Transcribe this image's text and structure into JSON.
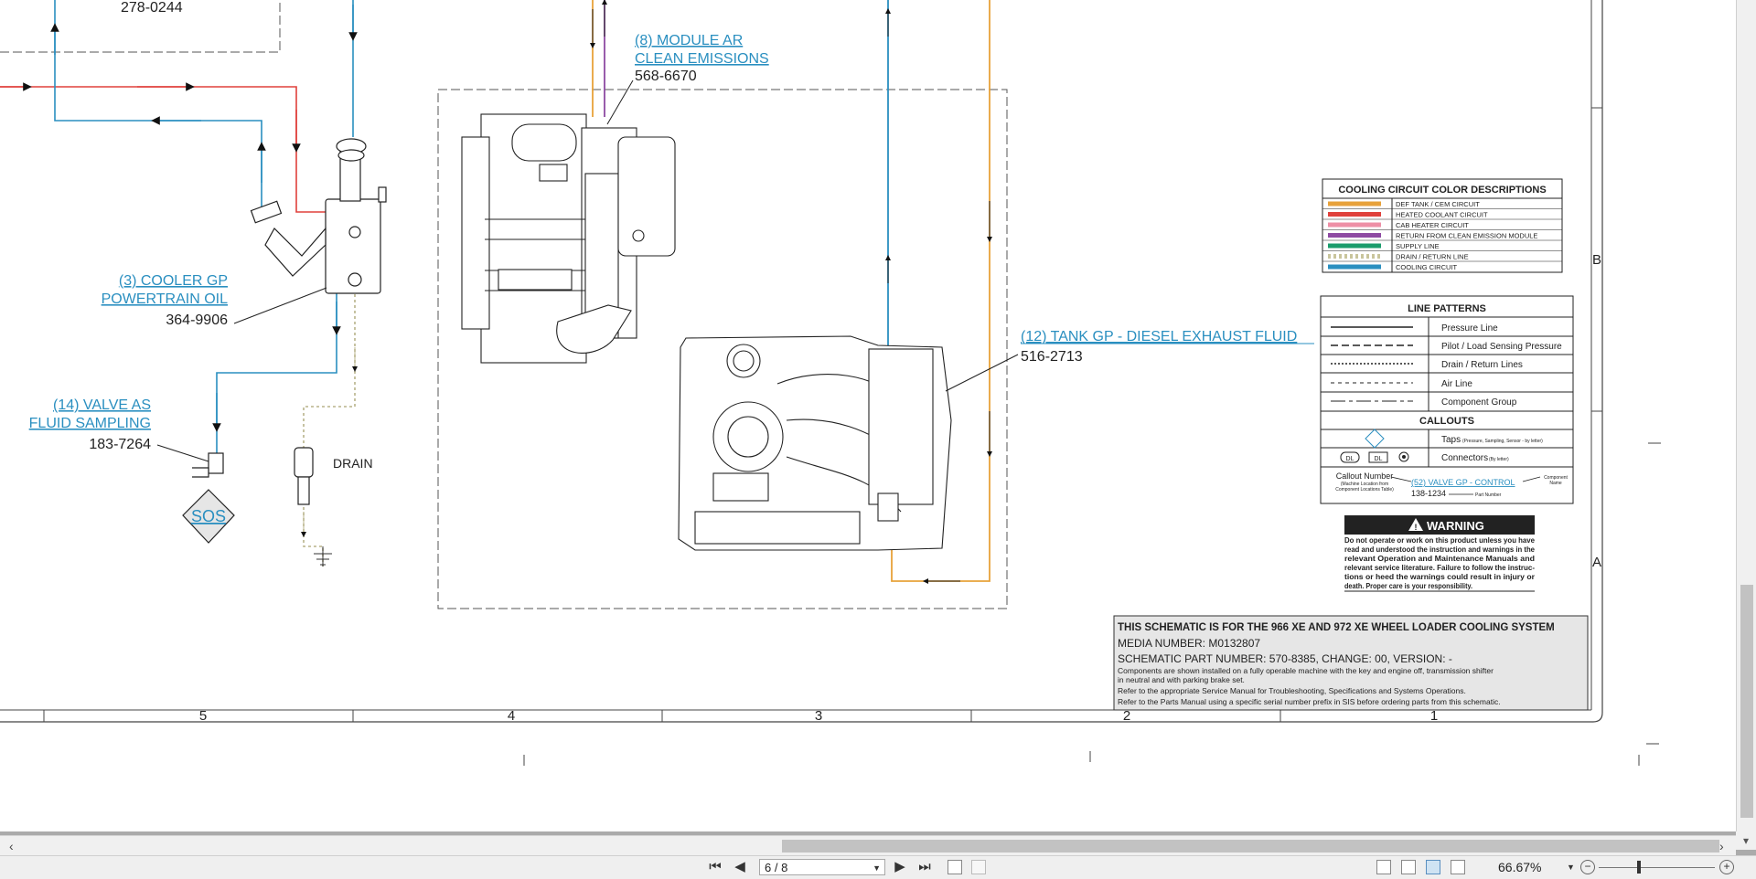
{
  "viewer": {
    "page_indicator": "6 / 8",
    "zoom": "66.67%"
  },
  "schematic": {
    "top_left_number": "278-0244",
    "callouts": {
      "module_ar": {
        "label_line1": "(8) MODULE AR",
        "label_line2": "CLEAN EMISSIONS",
        "part": "568-6670"
      },
      "cooler": {
        "label_line1": "(3) COOLER GP",
        "label_line2": "POWERTRAIN OIL",
        "part": "364-9906"
      },
      "valve": {
        "label_line1": "(14) VALVE AS",
        "label_line2": "FLUID SAMPLING",
        "part": "183-7264"
      },
      "tank": {
        "label": "(12) TANK GP - DIESEL EXHAUST FLUID",
        "part": "516-2713"
      }
    },
    "sos_label": "SOS",
    "drain_label": "DRAIN",
    "row_markers": [
      "B",
      "A"
    ],
    "column_numbers": [
      "5",
      "4",
      "3",
      "2",
      "1"
    ]
  },
  "legend_colors": {
    "title": "COOLING CIRCUIT COLOR DESCRIPTIONS",
    "items": [
      {
        "label": "DEF TANK / CEM CIRCUIT",
        "color": "#e8a23a"
      },
      {
        "label": "HEATED COOLANT CIRCUIT",
        "color": "#e0413c"
      },
      {
        "label": "CAB HEATER CIRCUIT",
        "color": "#ee8fa6"
      },
      {
        "label": "RETURN FROM CLEAN EMISSION MODULE",
        "color": "#8e4aa2"
      },
      {
        "label": "SUPPLY LINE",
        "color": "#1a9c6c"
      },
      {
        "label": "DRAIN / RETURN LINE",
        "color": "#c9c59c"
      },
      {
        "label": "COOLING CIRCUIT",
        "color": "#2a8fc0"
      }
    ]
  },
  "legend_lines": {
    "title": "LINE PATTERNS",
    "patterns": [
      "Pressure Line",
      "Pilot / Load Sensing Pressure",
      "Drain / Return Lines",
      "Air Line",
      "Component Group"
    ],
    "callouts_title": "CALLOUTS",
    "taps_label": "Taps",
    "taps_note": "(Pressure, Sampling, Sensor - by letter)",
    "connectors_label": "Connectors",
    "connectors_note": "(By letter)",
    "connector_tag": "DL",
    "callout_number_label": "Callout Number",
    "callout_number_note1": "(Machine Location from",
    "callout_number_note2": "Component Locations Table)",
    "example_callout": "(52) VALVE GP - CONTROL",
    "example_part": "138-1234",
    "component_name_line1": "Component",
    "component_name_line2": "Name",
    "part_number_label": "Part Number"
  },
  "warning": {
    "title": "WARNING",
    "lines": [
      "Do not operate or work on this product unless you have",
      "read and understood the instruction and warnings in the",
      "relevant Operation and Maintenance Manuals and",
      "relevant service literature. Failure to follow the instruc-",
      "tions or heed the warnings could result in injury or",
      "death. Proper care is your responsibility."
    ]
  },
  "titleblock": {
    "title": "THIS SCHEMATIC IS FOR THE 966 XE AND 972 XE WHEEL LOADER COOLING SYSTEM",
    "media": "MEDIA NUMBER: M0132807",
    "part": "SCHEMATIC PART NUMBER: 570-8385, CHANGE: 00, VERSION: -",
    "note1": "Components are shown installed on a fully operable machine with the key and engine off, transmission shifter",
    "note2": "in neutral and with parking brake set.",
    "note3": "Refer to the appropriate Service Manual for Troubleshooting, Specifications and Systems Operations.",
    "note4": "Refer to the Parts Manual using a specific serial number prefix in SIS before ordering parts from this schematic."
  }
}
